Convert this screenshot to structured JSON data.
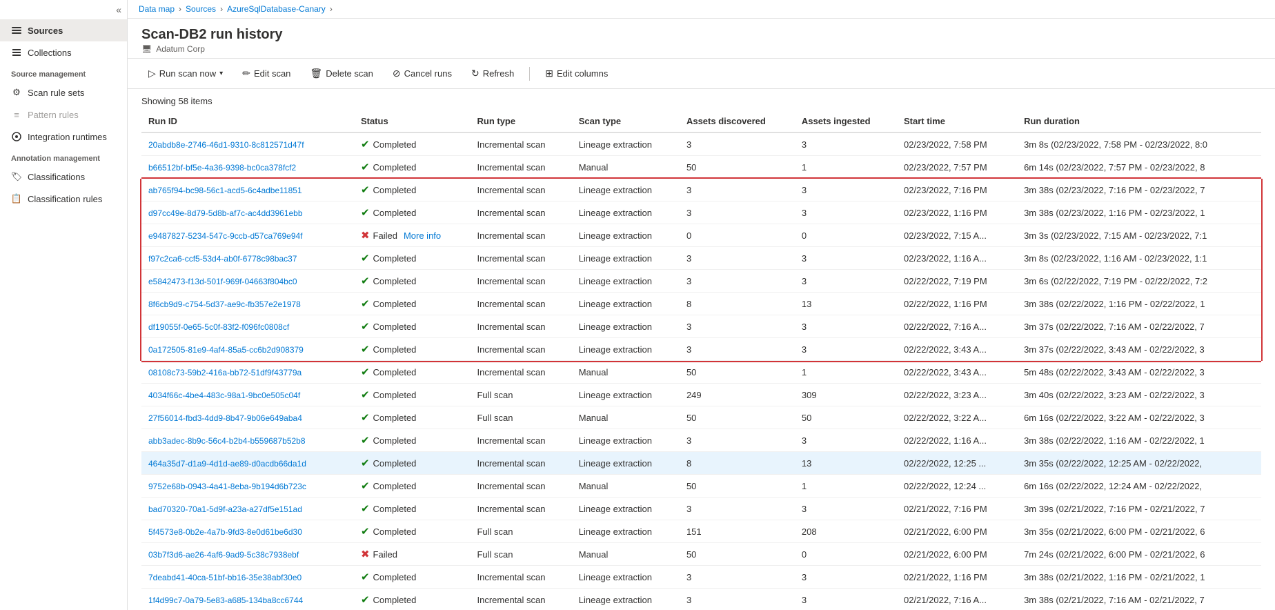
{
  "breadcrumb": {
    "items": [
      "Data map",
      "Sources",
      "AzureSqlDatabase-Canary"
    ]
  },
  "sidebar": {
    "collapse_label": "«",
    "items": [
      {
        "id": "sources",
        "label": "Sources",
        "icon": "🗄",
        "active": true,
        "section": null
      },
      {
        "id": "collections",
        "label": "Collections",
        "icon": "📁",
        "active": false,
        "section": null
      },
      {
        "id": "source-management",
        "label": "Source management",
        "icon": null,
        "section": true
      },
      {
        "id": "scan-rule-sets",
        "label": "Scan rule sets",
        "icon": "⚙",
        "active": false,
        "section": false
      },
      {
        "id": "pattern-rules",
        "label": "Pattern rules",
        "icon": "≡",
        "active": false,
        "section": false,
        "disabled": true
      },
      {
        "id": "integration-runtimes",
        "label": "Integration runtimes",
        "icon": "⊕",
        "active": false,
        "section": false
      },
      {
        "id": "annotation-management",
        "label": "Annotation management",
        "icon": null,
        "section": true
      },
      {
        "id": "classifications",
        "label": "Classifications",
        "icon": "🏷",
        "active": false,
        "section": false
      },
      {
        "id": "classification-rules",
        "label": "Classification rules",
        "icon": "📋",
        "active": false,
        "section": false
      }
    ]
  },
  "page": {
    "title": "Scan-DB2 run history",
    "subtitle_icon": "🖥",
    "subtitle": "Adatum Corp"
  },
  "toolbar": {
    "run_scan_label": "Run scan now",
    "edit_scan_label": "Edit scan",
    "delete_scan_label": "Delete scan",
    "cancel_runs_label": "Cancel runs",
    "refresh_label": "Refresh",
    "edit_columns_label": "Edit columns"
  },
  "table": {
    "showing": "Showing 58 items",
    "columns": [
      "Run ID",
      "Status",
      "Run type",
      "Scan type",
      "Assets discovered",
      "Assets ingested",
      "Start time",
      "Run duration"
    ],
    "rows": [
      {
        "run_id": "20abdb8e-2746-46d1-9310-8c812571d47f",
        "status": "Completed",
        "status_ok": true,
        "run_type": "Incremental scan",
        "scan_type": "Lineage extraction",
        "assets_disc": 3,
        "assets_ing": 3,
        "start_time": "02/23/2022, 7:58 PM",
        "run_dur": "3m 8s (02/23/2022, 7:58 PM - 02/23/2022, 8:0",
        "selected": false,
        "highlighted": false
      },
      {
        "run_id": "b66512bf-bf5e-4a36-9398-bc0ca378fcf2",
        "status": "Completed",
        "status_ok": true,
        "run_type": "Incremental scan",
        "scan_type": "Manual",
        "assets_disc": 50,
        "assets_ing": 1,
        "start_time": "02/23/2022, 7:57 PM",
        "run_dur": "6m 14s (02/23/2022, 7:57 PM - 02/23/2022, 8",
        "selected": false,
        "highlighted": false
      },
      {
        "run_id": "ab765f94-bc98-56c1-acd5-6c4adbe11851",
        "status": "Completed",
        "status_ok": true,
        "run_type": "Incremental scan",
        "scan_type": "Lineage extraction",
        "assets_disc": 3,
        "assets_ing": 3,
        "start_time": "02/23/2022, 7:16 PM",
        "run_dur": "3m 38s (02/23/2022, 7:16 PM - 02/23/2022, 7",
        "selected": false,
        "highlighted": true
      },
      {
        "run_id": "d97cc49e-8d79-5d8b-af7c-ac4dd3961ebb",
        "status": "Completed",
        "status_ok": true,
        "run_type": "Incremental scan",
        "scan_type": "Lineage extraction",
        "assets_disc": 3,
        "assets_ing": 3,
        "start_time": "02/23/2022, 1:16 PM",
        "run_dur": "3m 38s (02/23/2022, 1:16 PM - 02/23/2022, 1",
        "selected": false,
        "highlighted": true
      },
      {
        "run_id": "e9487827-5234-547c-9ccb-d57ca769e94f",
        "status": "Failed",
        "status_ok": false,
        "more_info": true,
        "run_type": "Incremental scan",
        "scan_type": "Lineage extraction",
        "assets_disc": 0,
        "assets_ing": 0,
        "start_time": "02/23/2022, 7:15 A...",
        "run_dur": "3m 3s (02/23/2022, 7:15 AM - 02/23/2022, 7:1",
        "selected": false,
        "highlighted": true
      },
      {
        "run_id": "f97c2ca6-ccf5-53d4-ab0f-6778c98bac37",
        "status": "Completed",
        "status_ok": true,
        "run_type": "Incremental scan",
        "scan_type": "Lineage extraction",
        "assets_disc": 3,
        "assets_ing": 3,
        "start_time": "02/23/2022, 1:16 A...",
        "run_dur": "3m 8s (02/23/2022, 1:16 AM - 02/23/2022, 1:1",
        "selected": false,
        "highlighted": true
      },
      {
        "run_id": "e5842473-f13d-501f-969f-04663f804bc0",
        "status": "Completed",
        "status_ok": true,
        "run_type": "Incremental scan",
        "scan_type": "Lineage extraction",
        "assets_disc": 3,
        "assets_ing": 3,
        "start_time": "02/22/2022, 7:19 PM",
        "run_dur": "3m 6s (02/22/2022, 7:19 PM - 02/22/2022, 7:2",
        "selected": false,
        "highlighted": true
      },
      {
        "run_id": "8f6cb9d9-c754-5d37-ae9c-fb357e2e1978",
        "status": "Completed",
        "status_ok": true,
        "run_type": "Incremental scan",
        "scan_type": "Lineage extraction",
        "assets_disc": 8,
        "assets_ing": 13,
        "start_time": "02/22/2022, 1:16 PM",
        "run_dur": "3m 38s (02/22/2022, 1:16 PM - 02/22/2022, 1",
        "selected": false,
        "highlighted": true
      },
      {
        "run_id": "df19055f-0e65-5c0f-83f2-f096fc0808cf",
        "status": "Completed",
        "status_ok": true,
        "run_type": "Incremental scan",
        "scan_type": "Lineage extraction",
        "assets_disc": 3,
        "assets_ing": 3,
        "start_time": "02/22/2022, 7:16 A...",
        "run_dur": "3m 37s (02/22/2022, 7:16 AM - 02/22/2022, 7",
        "selected": false,
        "highlighted": true
      },
      {
        "run_id": "0a172505-81e9-4af4-85a5-cc6b2d908379",
        "status": "Completed",
        "status_ok": true,
        "run_type": "Incremental scan",
        "scan_type": "Lineage extraction",
        "assets_disc": 3,
        "assets_ing": 3,
        "start_time": "02/22/2022, 3:43 A...",
        "run_dur": "3m 37s (02/22/2022, 3:43 AM - 02/22/2022, 3",
        "selected": false,
        "highlighted": true
      },
      {
        "run_id": "08108c73-59b2-416a-bb72-51df9f43779a",
        "status": "Completed",
        "status_ok": true,
        "run_type": "Incremental scan",
        "scan_type": "Manual",
        "assets_disc": 50,
        "assets_ing": 1,
        "start_time": "02/22/2022, 3:43 A...",
        "run_dur": "5m 48s (02/22/2022, 3:43 AM - 02/22/2022, 3",
        "selected": false,
        "highlighted": false
      },
      {
        "run_id": "4034f66c-4be4-483c-98a1-9bc0e505c04f",
        "status": "Completed",
        "status_ok": true,
        "run_type": "Full scan",
        "scan_type": "Lineage extraction",
        "assets_disc": 249,
        "assets_ing": 309,
        "start_time": "02/22/2022, 3:23 A...",
        "run_dur": "3m 40s (02/22/2022, 3:23 AM - 02/22/2022, 3",
        "selected": false,
        "highlighted": false
      },
      {
        "run_id": "27f56014-fbd3-4dd9-8b47-9b06e649aba4",
        "status": "Completed",
        "status_ok": true,
        "run_type": "Full scan",
        "scan_type": "Manual",
        "assets_disc": 50,
        "assets_ing": 50,
        "start_time": "02/22/2022, 3:22 A...",
        "run_dur": "6m 16s (02/22/2022, 3:22 AM - 02/22/2022, 3",
        "selected": false,
        "highlighted": false
      },
      {
        "run_id": "abb3adec-8b9c-56c4-b2b4-b559687b52b8",
        "status": "Completed",
        "status_ok": true,
        "run_type": "Incremental scan",
        "scan_type": "Lineage extraction",
        "assets_disc": 3,
        "assets_ing": 3,
        "start_time": "02/22/2022, 1:16 A...",
        "run_dur": "3m 38s (02/22/2022, 1:16 AM - 02/22/2022, 1",
        "selected": false,
        "highlighted": false
      },
      {
        "run_id": "464a35d7-d1a9-4d1d-ae89-d0acdb66da1d",
        "status": "Completed",
        "status_ok": true,
        "run_type": "Incremental scan",
        "scan_type": "Lineage extraction",
        "assets_disc": 8,
        "assets_ing": 13,
        "start_time": "02/22/2022, 12:25 ...",
        "run_dur": "3m 35s (02/22/2022, 12:25 AM - 02/22/2022,",
        "selected": true,
        "highlighted": false
      },
      {
        "run_id": "9752e68b-0943-4a41-8eba-9b194d6b723c",
        "status": "Completed",
        "status_ok": true,
        "run_type": "Incremental scan",
        "scan_type": "Manual",
        "assets_disc": 50,
        "assets_ing": 1,
        "start_time": "02/22/2022, 12:24 ...",
        "run_dur": "6m 16s (02/22/2022, 12:24 AM - 02/22/2022,",
        "selected": false,
        "highlighted": false
      },
      {
        "run_id": "bad70320-70a1-5d9f-a23a-a27df5e151ad",
        "status": "Completed",
        "status_ok": true,
        "run_type": "Incremental scan",
        "scan_type": "Lineage extraction",
        "assets_disc": 3,
        "assets_ing": 3,
        "start_time": "02/21/2022, 7:16 PM",
        "run_dur": "3m 39s (02/21/2022, 7:16 PM - 02/21/2022, 7",
        "selected": false,
        "highlighted": false
      },
      {
        "run_id": "5f4573e8-0b2e-4a7b-9fd3-8e0d61be6d30",
        "status": "Completed",
        "status_ok": true,
        "run_type": "Full scan",
        "scan_type": "Lineage extraction",
        "assets_disc": 151,
        "assets_ing": 208,
        "start_time": "02/21/2022, 6:00 PM",
        "run_dur": "3m 35s (02/21/2022, 6:00 PM - 02/21/2022, 6",
        "selected": false,
        "highlighted": false
      },
      {
        "run_id": "03b7f3d6-ae26-4af6-9ad9-5c38c7938ebf",
        "status": "Failed",
        "status_ok": false,
        "run_type": "Full scan",
        "scan_type": "Manual",
        "assets_disc": 50,
        "assets_ing": 0,
        "start_time": "02/21/2022, 6:00 PM",
        "run_dur": "7m 24s (02/21/2022, 6:00 PM - 02/21/2022, 6",
        "selected": false,
        "highlighted": false
      },
      {
        "run_id": "7deabd41-40ca-51bf-bb16-35e38abf30e0",
        "status": "Completed",
        "status_ok": true,
        "run_type": "Incremental scan",
        "scan_type": "Lineage extraction",
        "assets_disc": 3,
        "assets_ing": 3,
        "start_time": "02/21/2022, 1:16 PM",
        "run_dur": "3m 38s (02/21/2022, 1:16 PM - 02/21/2022, 1",
        "selected": false,
        "highlighted": false
      },
      {
        "run_id": "1f4d99c7-0a79-5e83-a685-134ba8cc6744",
        "status": "Completed",
        "status_ok": true,
        "run_type": "Incremental scan",
        "scan_type": "Lineage extraction",
        "assets_disc": 3,
        "assets_ing": 3,
        "start_time": "02/21/2022, 7:16 A...",
        "run_dur": "3m 38s (02/21/2022, 7:16 AM - 02/21/2022, 7",
        "selected": false,
        "highlighted": false
      }
    ]
  }
}
